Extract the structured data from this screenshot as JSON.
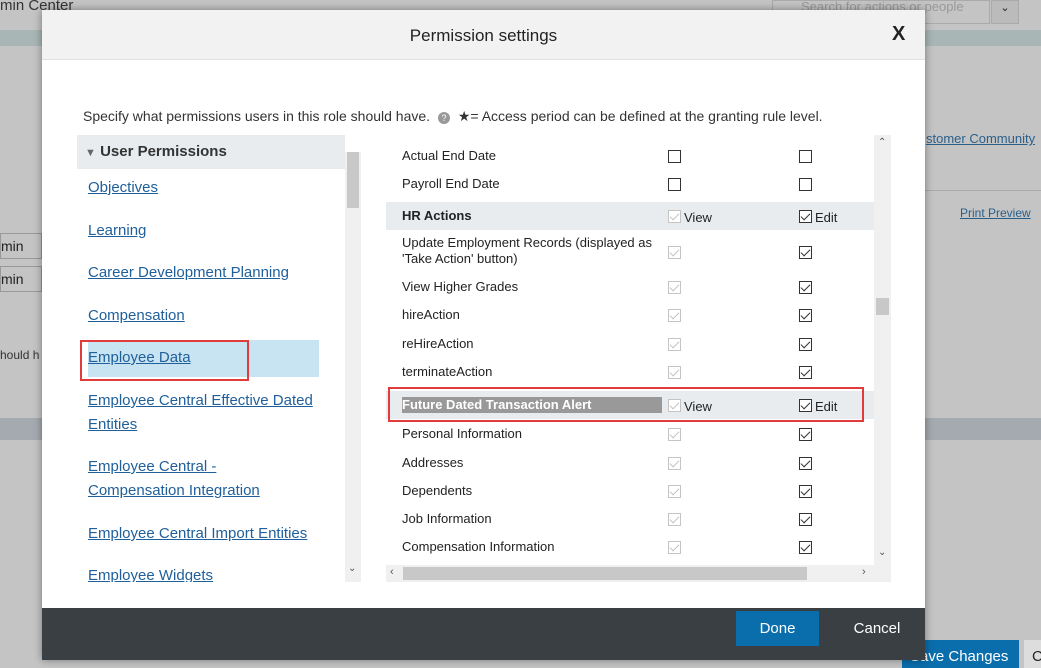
{
  "background": {
    "app_title": "min Center",
    "search_placeholder": "Search for actions or people",
    "community_link": "stomer Community",
    "print_preview": "Print Preview",
    "field1": "min",
    "field2": "min",
    "partial_text": "hould h",
    "save_changes": "Save Changes",
    "partial_button": "C"
  },
  "modal": {
    "title": "Permission settings",
    "close_label": "X",
    "description": "Specify what permissions users in this role should have.",
    "access_note": "★= Access period can be defined at the granting rule level.",
    "left_header": "User Permissions",
    "categories": [
      "Objectives",
      "Learning",
      "Career Development Planning",
      "Compensation",
      "Employee Data",
      "Employee Central Effective Dated Entities",
      "Employee Central - Compensation Integration",
      "Employee Central Import Entities",
      "Employee Widgets"
    ],
    "selected_category": "Employee Data",
    "rows": [
      {
        "label": "Actual End Date",
        "view": false,
        "edit": false,
        "view_disabled": false
      },
      {
        "label": "Payroll End Date",
        "view": false,
        "edit": false,
        "view_disabled": false
      },
      {
        "label": "HR Actions",
        "header": true,
        "view": true,
        "edit": true,
        "view_disabled": true,
        "view_label": "View",
        "edit_label": "Edit"
      },
      {
        "label": "Update Employment Records (displayed as 'Take Action' button)",
        "view": true,
        "edit": true,
        "view_disabled": true
      },
      {
        "label": "View Higher Grades",
        "view": true,
        "edit": true,
        "view_disabled": true
      },
      {
        "label": "hireAction",
        "view": true,
        "edit": true,
        "view_disabled": true
      },
      {
        "label": "reHireAction",
        "view": true,
        "edit": true,
        "view_disabled": true
      },
      {
        "label": "terminateAction",
        "view": true,
        "edit": true,
        "view_disabled": true
      },
      {
        "label": "Future Dated Transaction Alert",
        "header": true,
        "highlighted": true,
        "view": true,
        "edit": true,
        "view_disabled": true,
        "view_label": "View",
        "edit_label": "Edit"
      },
      {
        "label": "Personal Information",
        "view": true,
        "edit": true,
        "view_disabled": true
      },
      {
        "label": "Addresses",
        "view": true,
        "edit": true,
        "view_disabled": true
      },
      {
        "label": "Dependents",
        "view": true,
        "edit": true,
        "view_disabled": true
      },
      {
        "label": "Job Information",
        "view": true,
        "edit": true,
        "view_disabled": true
      },
      {
        "label": "Compensation Information",
        "view": true,
        "edit": true,
        "view_disabled": true
      }
    ],
    "done_label": "Done",
    "cancel_label": "Cancel"
  },
  "colors": {
    "accent": "#0a6ead",
    "link": "#1f5f9a",
    "highlight": "#e03c3c",
    "footer": "#3a3f44"
  }
}
